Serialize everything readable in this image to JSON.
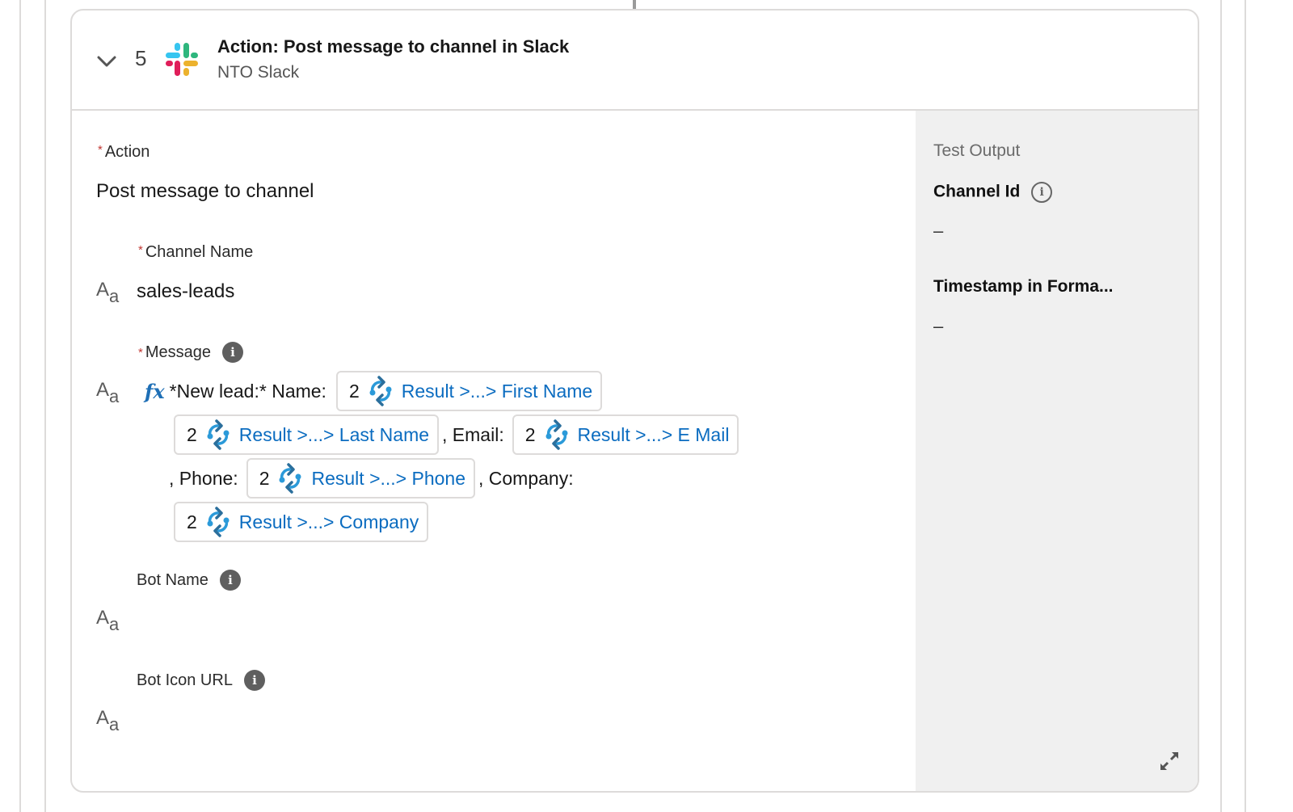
{
  "step": {
    "number": "5",
    "title": "Action: Post message to channel in Slack",
    "subtitle": "NTO Slack",
    "app_icon": "slack-logo-icon",
    "toggle_icon": "chevron-down-icon"
  },
  "form": {
    "action": {
      "label": "Action",
      "required_marker": "*",
      "value": "Post message to channel"
    },
    "channel_name": {
      "label": "Channel Name",
      "required_marker": "*",
      "type_icon": "Aa",
      "value": "sales-leads"
    },
    "message": {
      "label": "Message",
      "required_marker": "*",
      "info_icon": "i",
      "type_icon": "Aa",
      "formula_icon": "fx",
      "prefix": "*New lead:* Name:",
      "sep_email": ", Email:",
      "sep_phone": ", Phone:",
      "sep_company": ", Company:",
      "tokens": [
        {
          "step": "2",
          "label": "Result >...> First Name"
        },
        {
          "step": "2",
          "label": "Result >...> Last Name"
        },
        {
          "step": "2",
          "label": "Result >...> E Mail"
        },
        {
          "step": "2",
          "label": "Result >...> Phone"
        },
        {
          "step": "2",
          "label": "Result >...> Company"
        }
      ]
    },
    "bot_name": {
      "label": "Bot Name",
      "info_icon": "i",
      "type_icon": "Aa",
      "value": ""
    },
    "bot_icon_url": {
      "label": "Bot Icon URL",
      "info_icon": "i",
      "type_icon": "Aa",
      "value": ""
    }
  },
  "test_output": {
    "title": "Test Output",
    "fields": [
      {
        "label": "Channel Id",
        "info_icon": "i",
        "value": "–"
      },
      {
        "label": "Timestamp in Forma...",
        "value": "–"
      }
    ],
    "expand_icon": "expand-icon"
  },
  "colors": {
    "link_blue": "#0b6cc0",
    "required_red": "#c23934",
    "panel_gray": "#f0f0f0",
    "border": "#dddbda"
  }
}
